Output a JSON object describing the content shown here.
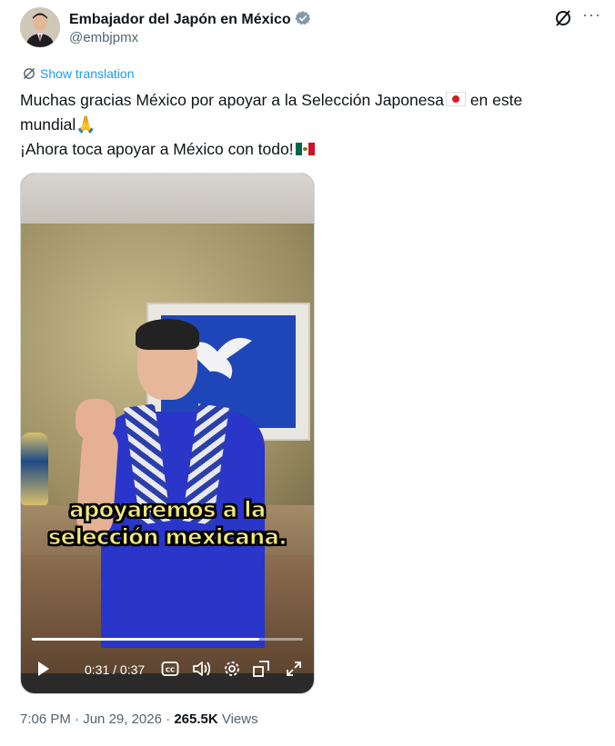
{
  "account": {
    "display_name": "Embajador del Japón en México",
    "handle": "@embjpmx"
  },
  "translate_label": "Show translation",
  "tweet": {
    "line1": "Muchas gracias México por apoyar a la Selección Japonesa",
    "line1_tail": " en este",
    "line2": "mundial",
    "line3": "¡Ahora toca apoyar a México con todo!"
  },
  "video": {
    "caption_line1": "apoyaremos a la",
    "caption_line2": "selección mexicana.",
    "time_display": "0:31 / 0:37",
    "progress_fraction": 0.84
  },
  "meta": {
    "time": "7:06 PM",
    "date": "Jun 29, 2026",
    "views_count": "265.5K",
    "views_label": "Views"
  },
  "icons": [
    "verified-badge-icon",
    "grok-icon",
    "more-icon",
    "translate-icon",
    "play-icon",
    "captions-icon",
    "volume-icon",
    "settings-icon",
    "pip-icon",
    "fullscreen-icon"
  ],
  "colors": {
    "link": "#1d9bf0",
    "secondary": "#536471",
    "caption": "#f1e87a"
  }
}
